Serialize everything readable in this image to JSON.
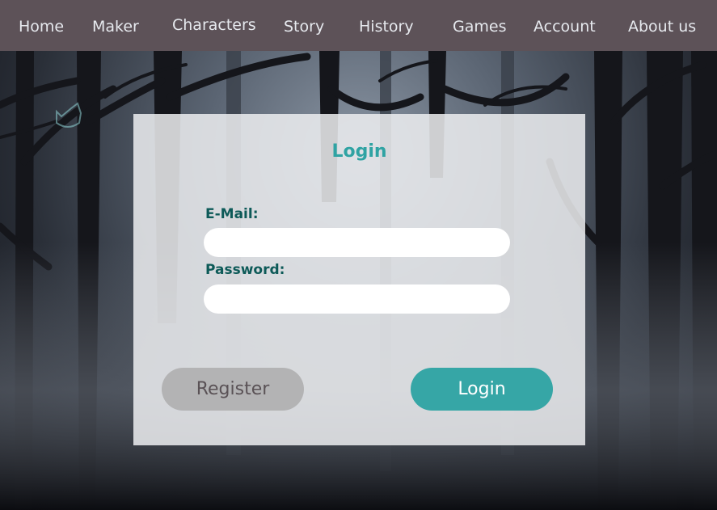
{
  "nav": {
    "items": [
      {
        "label": "Home"
      },
      {
        "label": "Maker"
      },
      {
        "label": "Characters"
      },
      {
        "label": "Story"
      },
      {
        "label": "History"
      },
      {
        "label": "Games"
      },
      {
        "label": "Account"
      },
      {
        "label": "About us"
      }
    ]
  },
  "login_form": {
    "title": "Login",
    "email_label": "E-Mail:",
    "email_value": "",
    "password_label": "Password:",
    "password_value": "",
    "register_button": "Register",
    "login_button": "Login"
  },
  "colors": {
    "navbar": "#5d5258",
    "accent": "#36a6a6",
    "label": "#0d5a58",
    "register_button": "#b3b3b4"
  },
  "icons": {
    "decoration": "cat-outline-icon"
  }
}
